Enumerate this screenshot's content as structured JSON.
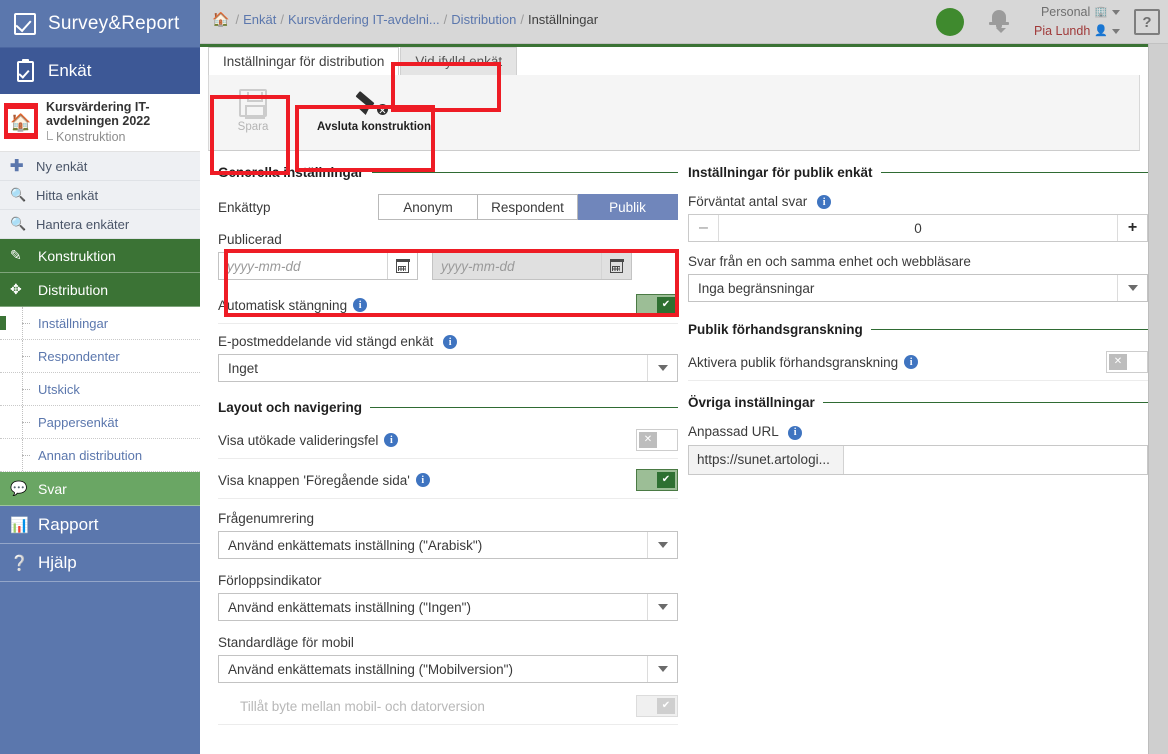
{
  "brand": {
    "name": "Survey&Report",
    "icon": "checkbox-checked-icon"
  },
  "sidebar": {
    "section_label": "Enkät",
    "survey": {
      "title": "Kursvärdering IT-avdelningen 2022",
      "sub": "Konstruktion",
      "home_icon": "home-icon"
    },
    "quick_items": [
      {
        "label": "Ny enkät",
        "icon": "plus-icon"
      },
      {
        "label": "Hitta enkät",
        "icon": "search-icon"
      },
      {
        "label": "Hantera enkäter",
        "icon": "search-icon"
      }
    ],
    "main_items": [
      {
        "label": "Konstruktion",
        "icon": "pencil-icon"
      },
      {
        "label": "Distribution",
        "icon": "share-icon"
      }
    ],
    "sub_items": [
      {
        "label": "Inställningar"
      },
      {
        "label": "Respondenter"
      },
      {
        "label": "Utskick"
      },
      {
        "label": "Pappersenkät"
      },
      {
        "label": "Annan distribution"
      }
    ],
    "svar": {
      "label": "Svar",
      "icon": "speech-check-icon"
    },
    "rapport": {
      "label": "Rapport",
      "icon": "bar-chart-icon"
    },
    "hjalp": {
      "label": "Hjälp",
      "icon": "question-book-icon"
    }
  },
  "topbar": {
    "breadcrumb": {
      "home_icon": "home-icon",
      "items": [
        "Enkät",
        "Kursvärdering IT-avdelni...",
        "Distribution",
        "Inställningar"
      ],
      "separator": "/"
    },
    "status_dot": "green-status-dot",
    "status_color": "#3f8a2e",
    "bell_icon": "bell-icon",
    "org": "Personal",
    "user": "Pia Lundh",
    "help_label": "?"
  },
  "tabs": [
    {
      "label": "Inställningar för distribution",
      "active": true
    },
    {
      "label": "Vid ifylld enkät",
      "active": false
    }
  ],
  "toolbar": {
    "save": {
      "label": "Spara",
      "icon": "floppy-disk-icon",
      "disabled": true
    },
    "end_construction": {
      "label": "Avsluta konstruktion",
      "icon": "pencil-cancel-icon",
      "disabled": false
    }
  },
  "left": {
    "section_title": "Generella inställningar",
    "survey_type": {
      "label": "Enkättyp",
      "options": [
        "Anonym",
        "Respondent",
        "Publik"
      ],
      "selected": "Publik"
    },
    "published": {
      "label": "Publicerad",
      "from_placeholder": "yyyy-mm-dd",
      "to_placeholder": "yyyy-mm-dd",
      "from_value": "",
      "to_value": "",
      "calendar_icon": "calendar-icon"
    },
    "auto_close": {
      "label": "Automatisk stängning",
      "state": "on"
    },
    "email_closed": {
      "label": "E-postmeddelande vid stängd enkät",
      "value": "Inget"
    },
    "layout_title": "Layout och navigering",
    "extended_validation": {
      "label": "Visa utökade valideringsfel",
      "state": "off"
    },
    "prev_button": {
      "label": "Visa knappen 'Föregående sida'",
      "state": "on"
    },
    "question_numbering": {
      "label": "Frågenumrering",
      "value": "Använd enkättemats inställning (\"Arabisk\")"
    },
    "progress_indicator": {
      "label": "Förloppsindikator",
      "value": "Använd enkättemats inställning (\"Ingen\")"
    },
    "mobile_mode": {
      "label": "Standardläge för mobil",
      "value": "Använd enkättemats inställning (\"Mobilversion\")"
    },
    "allow_switch": {
      "label": "Tillåt byte mellan mobil- och datorversion",
      "state": "disabled-on"
    }
  },
  "right": {
    "section_title": "Inställningar för publik enkät",
    "expected_answers": {
      "label": "Förväntat antal svar",
      "value": "0",
      "minus": "–",
      "plus": "+"
    },
    "same_device": {
      "label": "Svar från en och samma enhet och webbläsare",
      "value": "Inga begränsningar"
    },
    "preview_title": "Publik förhandsgranskning",
    "enable_preview": {
      "label": "Aktivera publik förhandsgranskning",
      "state": "off"
    },
    "other_title": "Övriga inställningar",
    "custom_url": {
      "label": "Anpassad URL",
      "prefix": "https://sunet.artologi...",
      "value": ""
    }
  },
  "colors": {
    "brand_blue": "#5b77ad",
    "nav_blue": "#3d5896",
    "green_dark": "#3b7335",
    "green_mid": "#6aa664",
    "annotation_red": "#ee1c25",
    "rule_green": "#2f6b33"
  }
}
